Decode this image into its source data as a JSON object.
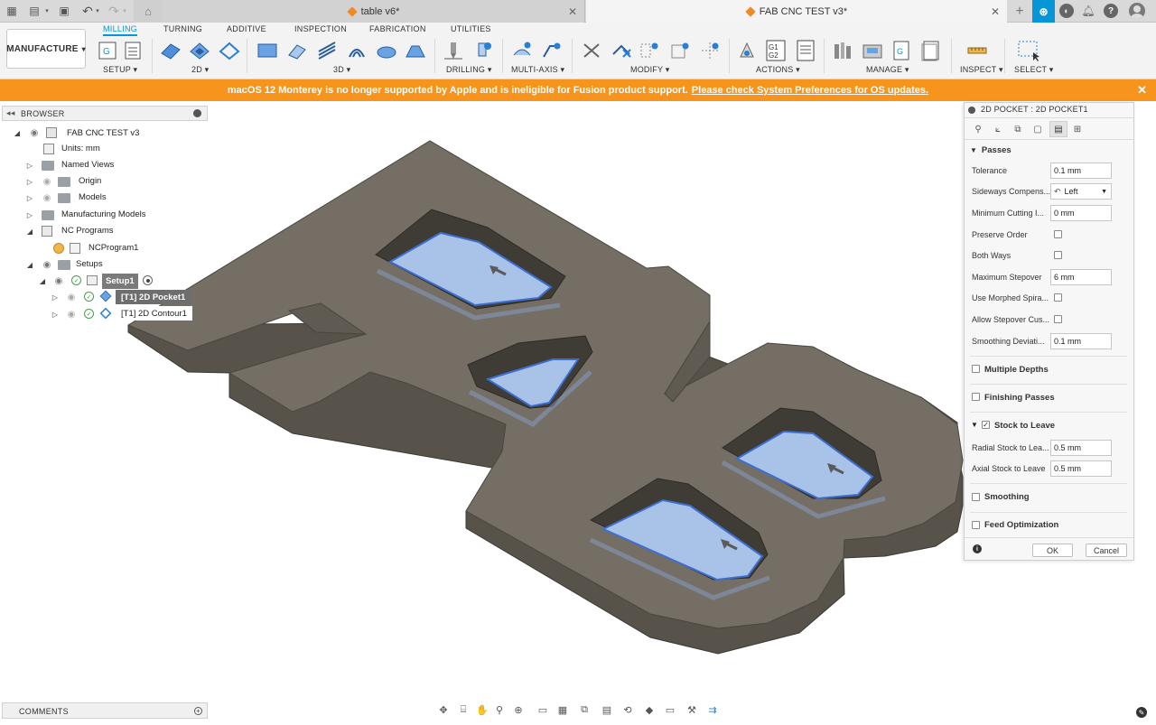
{
  "tabs": [
    {
      "title": "table v6*",
      "active": false
    },
    {
      "title": "FAB CNC TEST v3*",
      "active": true
    }
  ],
  "workspace": {
    "label": "MANUFACTURE"
  },
  "ribbon_tabs": [
    "MILLING",
    "TURNING",
    "ADDITIVE",
    "INSPECTION",
    "FABRICATION",
    "UTILITIES"
  ],
  "ribbon_groups": [
    "SETUP",
    "2D",
    "3D",
    "DRILLING",
    "MULTI-AXIS",
    "MODIFY",
    "ACTIONS",
    "MANAGE",
    "INSPECT",
    "SELECT"
  ],
  "banner": {
    "message": "macOS 12 Monterey is no longer supported by Apple and is ineligible for Fusion product support.",
    "link": "Please check System Preferences for OS updates."
  },
  "browser": {
    "title": "BROWSER",
    "items": [
      {
        "label": "FAB CNC TEST v3"
      },
      {
        "label": "Units: mm"
      },
      {
        "label": "Named Views"
      },
      {
        "label": "Origin"
      },
      {
        "label": "Models"
      },
      {
        "label": "Manufacturing Models"
      },
      {
        "label": "NC Programs"
      },
      {
        "label": "NCProgram1"
      },
      {
        "label": "Setups"
      },
      {
        "label": "Setup1"
      },
      {
        "label": "[T1] 2D Pocket1"
      },
      {
        "label": "[T1] 2D Contour1"
      }
    ]
  },
  "dialog": {
    "title": "2D POCKET : 2D POCKET1",
    "passes_label": "Passes",
    "fields": {
      "tolerance": {
        "label": "Tolerance",
        "value": "0.1 mm"
      },
      "sideways": {
        "label": "Sideways Compens...",
        "value": "Left"
      },
      "min_cutting": {
        "label": "Minimum Cutting I...",
        "value": "0 mm"
      },
      "preserve_order": {
        "label": "Preserve Order"
      },
      "both_ways": {
        "label": "Both Ways"
      },
      "max_stepover": {
        "label": "Maximum Stepover",
        "value": "6 mm"
      },
      "morphed": {
        "label": "Use Morphed Spira..."
      },
      "allow_stepover": {
        "label": "Allow Stepover Cus..."
      },
      "smoothing_dev": {
        "label": "Smoothing Deviati...",
        "value": "0.1 mm"
      },
      "radial_stock": {
        "label": "Radial Stock to Lea...",
        "value": "0.5 mm"
      },
      "axial_stock": {
        "label": "Axial Stock to Leave",
        "value": "0.5 mm"
      }
    },
    "sections": {
      "multiple_depths": "Multiple Depths",
      "finishing_passes": "Finishing Passes",
      "stock_to_leave": "Stock to Leave",
      "smoothing": "Smoothing",
      "feed_optimization": "Feed Optimization"
    },
    "ok": "OK",
    "cancel": "Cancel"
  },
  "comments": {
    "title": "COMMENTS"
  },
  "colors": {
    "accent": "#0696d7",
    "banner": "#f7941d",
    "part_top": "#746e64",
    "part_side": "#57524a",
    "pocket_floor": "#a9c2e8",
    "toolpath": "#3c6fd1"
  },
  "icons": [
    "grid-icon",
    "file-icon",
    "save-icon",
    "undo-icon",
    "redo-icon",
    "home-icon",
    "plus-icon",
    "notification-icon",
    "help-icon",
    "avatar"
  ]
}
